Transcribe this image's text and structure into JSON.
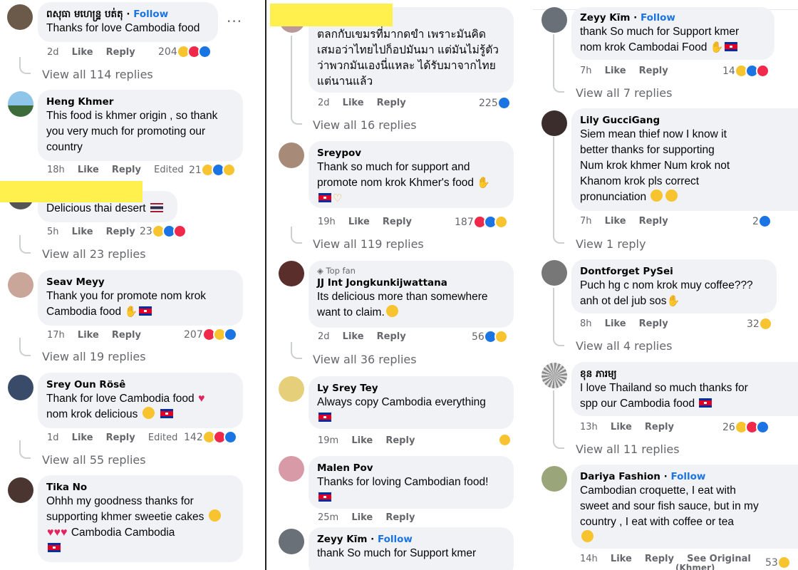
{
  "ui": {
    "like": "Like",
    "reply": "Reply",
    "edited": "Edited",
    "follow": "Follow",
    "top_fan": "Top fan",
    "see_original": "See Original",
    "see_original_lang": "(Khmer)"
  },
  "col1": [
    {
      "author": "ពសុធា មហេន្ទ្រ បត់តុ",
      "follow": true,
      "lines": [
        "Thanks for love Cambodia food"
      ],
      "time": "2d",
      "count": "204",
      "replies": "View all 114 replies"
    },
    {
      "author": "Heng Khmer",
      "lines": [
        "This food is khmer origin , so thank",
        "you very much for promoting our",
        "country"
      ],
      "time": "18h",
      "edited": true,
      "count": "21"
    },
    {
      "author": "",
      "lines": [
        "Delicious thai desert"
      ],
      "time": "5h",
      "count": "23",
      "replies": "View all 23 replies"
    },
    {
      "author": "Seav Meyy",
      "lines": [
        "Thank you for promote nom krok",
        "Cambodia food"
      ],
      "time": "17h",
      "count": "207",
      "replies": "View all 19 replies"
    },
    {
      "author": "Srey Oun Rösê",
      "lines": [
        "Thank for love Cambodia food",
        "nom krok delicious"
      ],
      "time": "1d",
      "edited": true,
      "count": "142",
      "replies": "View all 55 replies"
    },
    {
      "author": "Tika No",
      "lines": [
        "Ohhh my goodness thanks for",
        "supporting khmer sweetie cakes",
        "Cambodia  Cambodia"
      ]
    }
  ],
  "col2": [
    {
      "lines": [
        "ตลกกับเขมรที่มากดขำ เพราะมันคิด",
        "เสมอว่าไทยไปก็อปมันมา แต่มันไม่รู้ตัว",
        "ว่าพวกมันเองนี่แหละ ได้รับมาจากไทย",
        "แต่นานแล้ว"
      ],
      "time": "2d",
      "count": "225",
      "replies": "View all 16 replies"
    },
    {
      "author": "Sreypov",
      "lines": [
        "Thank so much for support and",
        "promote nom krok Khmer's food"
      ],
      "time": "19h",
      "count": "187",
      "replies": "View all 119 replies"
    },
    {
      "author": "JJ Int Jongkunkijwattana",
      "top_fan": true,
      "lines": [
        "Its delicious more than somewhere",
        "want to claim."
      ],
      "time": "2d",
      "count": "56",
      "replies": "View all 36 replies"
    },
    {
      "author": "Ly Srey Tey",
      "lines": [
        "Always copy Cambodia everything"
      ],
      "time": "19m"
    },
    {
      "author": "Malen Pov",
      "lines": [
        "Thanks for loving Cambodian food!"
      ],
      "time": "25m"
    },
    {
      "author": "Zeyy Kīm",
      "follow": true,
      "lines": [
        "thank So much for Support kmer"
      ]
    }
  ],
  "col3": [
    {
      "author": "Zeyy Kīm",
      "follow": true,
      "lines": [
        "thank So much for Support kmer",
        "nom krok Cambodai Food"
      ],
      "time": "7h",
      "count": "14",
      "replies": "View all 7 replies"
    },
    {
      "author": "Lily GucciGang",
      "lines": [
        "Siem mean thief now I know it",
        "better  thanks for supporting",
        "Num krok khmer  Num krok not",
        "Khanom krok pls correct",
        "pronunciation"
      ],
      "time": "7h",
      "count": "2",
      "replies": "View 1 reply"
    },
    {
      "author": "Dontforget PySei",
      "lines": [
        "Puch hg c nom krok muy coffee???",
        "anh ot del jub sos"
      ],
      "time": "8h",
      "count": "32",
      "replies": "View all 4 replies"
    },
    {
      "author": "ខុន ភារម្យ",
      "lines": [
        "I love Thailand so much thanks for",
        "spp our Cambodia food"
      ],
      "time": "13h",
      "count": "26",
      "replies": "View all 11 replies"
    },
    {
      "author": "Dariya Fashion",
      "follow": true,
      "lines": [
        "Cambodian croquette, I eat with",
        "sweet and sour fish sauce, but in my",
        "country  , I eat with coffee or tea"
      ],
      "time": "14h",
      "count": "53"
    }
  ]
}
